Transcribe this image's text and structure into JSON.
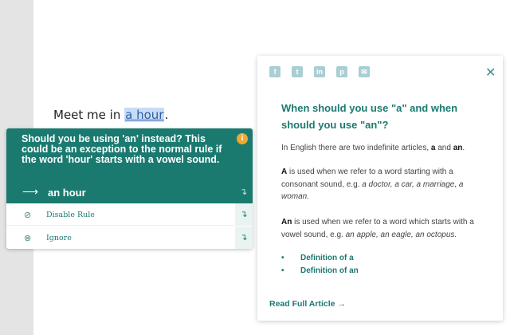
{
  "editor": {
    "sentence_before": "Meet me in ",
    "highlight": "a hour",
    "sentence_after": "."
  },
  "suggestion_popup": {
    "message": "Should you be using 'an' instead? This could be an exception to the normal rule if the word 'hour' starts with a vowel sound.",
    "info_icon": "i",
    "suggestion_arrow": "⟶",
    "suggestion_text": "an hour",
    "options": [
      {
        "icon": "eye-off-icon",
        "glyph": "⊘",
        "label": "Disable Rule"
      },
      {
        "icon": "x-circle-icon",
        "glyph": "⊗",
        "label": "Ignore"
      }
    ],
    "accent": "#1b7a70"
  },
  "article": {
    "share_icons": [
      {
        "name": "facebook-icon",
        "glyph": "f"
      },
      {
        "name": "twitter-icon",
        "glyph": "t"
      },
      {
        "name": "linkedin-icon",
        "glyph": "in"
      },
      {
        "name": "pinterest-icon",
        "glyph": "p"
      },
      {
        "name": "email-icon",
        "glyph": "✉"
      }
    ],
    "close_glyph": "✕",
    "title": "When should you use \"a\" and when should you use \"an\"?",
    "p1_a": "In English there are two indefinite articles, ",
    "p1_b": "a",
    "p1_c": " and ",
    "p1_d": "an",
    "p1_e": ".",
    "p2_a": "A",
    "p2_b": " is used when we refer to a word starting with a consonant sound, e.g. ",
    "p2_c": "a doctor, a car, a marriage, a woman.",
    "p3_a": "An",
    "p3_b": " is used when we refer to a word which starts with a vowel sound, e.g. ",
    "p3_c": "an apple, an eagle, an octopus.",
    "links": [
      {
        "bullet": "•",
        "label": "Definition of a"
      },
      {
        "bullet": "•",
        "label": "Definition of an"
      }
    ],
    "read_more": "Read Full Article",
    "read_more_arrow": "→"
  }
}
